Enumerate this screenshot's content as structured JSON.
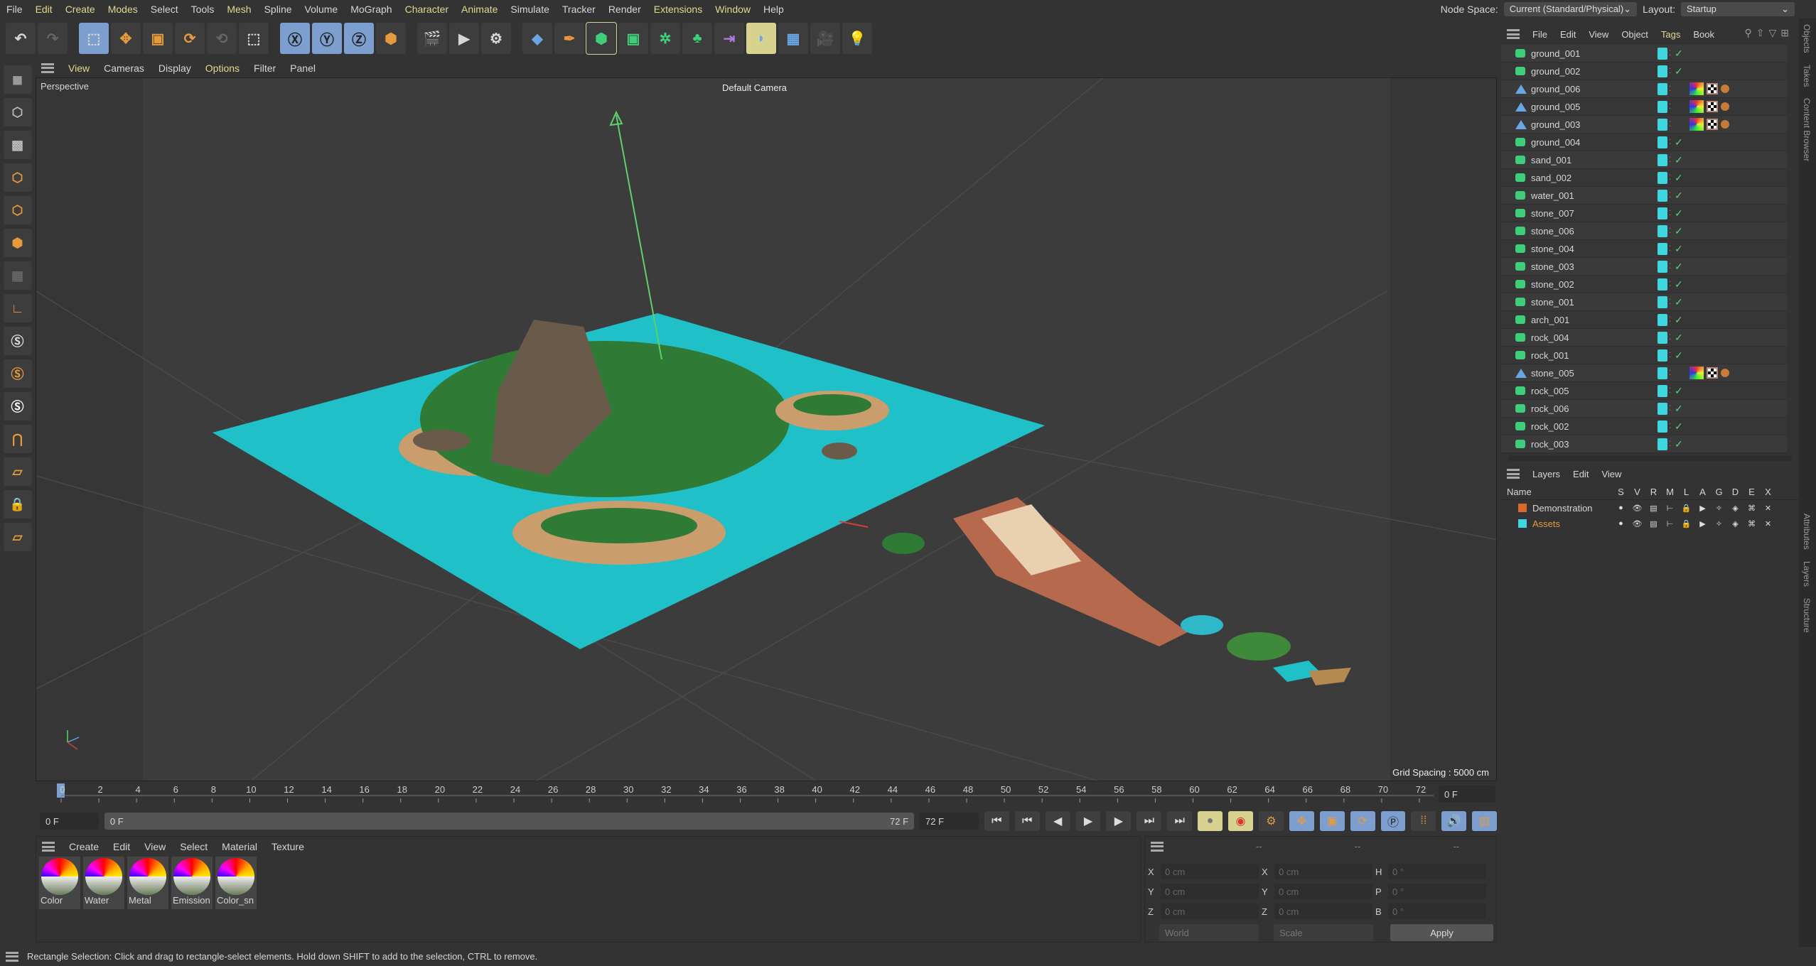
{
  "menu": [
    "File",
    "Edit",
    "Create",
    "Modes",
    "Select",
    "Tools",
    "Mesh",
    "Spline",
    "Volume",
    "MoGraph",
    "Character",
    "Animate",
    "Simulate",
    "Tracker",
    "Render",
    "Extensions",
    "Window",
    "Help"
  ],
  "menu_highlight": [
    1,
    2,
    3,
    6,
    10,
    11,
    15,
    16
  ],
  "node_space": {
    "label": "Node Space:",
    "value": "Current (Standard/Physical)"
  },
  "layout": {
    "label": "Layout:",
    "value": "Startup"
  },
  "viewport_menu": [
    "View",
    "Cameras",
    "Display",
    "Options",
    "Filter",
    "Panel"
  ],
  "viewport": {
    "name": "Perspective",
    "camera": "Default Camera",
    "grid_spacing": "Grid Spacing : 5000 cm",
    "plane_color": "#1fc0c8"
  },
  "timeline": {
    "ticks": [
      0,
      2,
      4,
      6,
      8,
      10,
      12,
      14,
      16,
      18,
      20,
      22,
      24,
      26,
      28,
      30,
      32,
      34,
      36,
      38,
      40,
      42,
      44,
      46,
      48,
      50,
      52,
      54,
      56,
      58,
      60,
      62,
      64,
      66,
      68,
      70,
      72
    ],
    "current_frame": "0 F",
    "start": "0 F",
    "range_start": "0 F",
    "range_end": "72 F",
    "end": "72 F",
    "right_frame": "0 F"
  },
  "materials": {
    "menu": [
      "Create",
      "Edit",
      "View",
      "Select",
      "Material",
      "Texture"
    ],
    "items": [
      "Color",
      "Water",
      "Metal",
      "Emission",
      "Color_sn"
    ]
  },
  "coords": {
    "headers": [
      "--",
      "--",
      "--"
    ],
    "rows": [
      [
        "X",
        "0 cm",
        "X",
        "0 cm",
        "H",
        "0 °"
      ],
      [
        "Y",
        "0 cm",
        "Y",
        "0 cm",
        "P",
        "0 °"
      ],
      [
        "Z",
        "0 cm",
        "Z",
        "0 cm",
        "B",
        "0 °"
      ]
    ],
    "mode1": "World",
    "mode2": "Scale",
    "apply": "Apply"
  },
  "status": "Rectangle Selection: Click and drag to rectangle-select elements. Hold down SHIFT to add to the selection, CTRL to remove.",
  "objects": {
    "menu": [
      "File",
      "Edit",
      "View",
      "Object",
      "Tags",
      "Book"
    ],
    "items": [
      {
        "name": "ground_001",
        "type": "poly"
      },
      {
        "name": "ground_002",
        "type": "poly"
      },
      {
        "name": "ground_006",
        "type": "null",
        "tags": true
      },
      {
        "name": "ground_005",
        "type": "null",
        "tags": true
      },
      {
        "name": "ground_003",
        "type": "null",
        "tags": true
      },
      {
        "name": "ground_004",
        "type": "poly"
      },
      {
        "name": "sand_001",
        "type": "poly"
      },
      {
        "name": "sand_002",
        "type": "poly"
      },
      {
        "name": "water_001",
        "type": "poly"
      },
      {
        "name": "stone_007",
        "type": "poly"
      },
      {
        "name": "stone_006",
        "type": "poly"
      },
      {
        "name": "stone_004",
        "type": "poly"
      },
      {
        "name": "stone_003",
        "type": "poly"
      },
      {
        "name": "stone_002",
        "type": "poly"
      },
      {
        "name": "stone_001",
        "type": "poly"
      },
      {
        "name": "arch_001",
        "type": "poly"
      },
      {
        "name": "rock_004",
        "type": "poly"
      },
      {
        "name": "rock_001",
        "type": "poly"
      },
      {
        "name": "stone_005",
        "type": "null",
        "tags": true
      },
      {
        "name": "rock_005",
        "type": "poly"
      },
      {
        "name": "rock_006",
        "type": "poly"
      },
      {
        "name": "rock_002",
        "type": "poly"
      },
      {
        "name": "rock_003",
        "type": "poly"
      }
    ]
  },
  "layers": {
    "menu": [
      "Layers",
      "Edit",
      "View"
    ],
    "name_header": "Name",
    "columns": [
      "S",
      "V",
      "R",
      "M",
      "L",
      "A",
      "G",
      "D",
      "E",
      "X"
    ],
    "items": [
      {
        "name": "Demonstration",
        "color": "#d9692a"
      },
      {
        "name": "Assets",
        "color": "#3fd6e0"
      }
    ]
  },
  "side_tabs": [
    "Objects",
    "Takes",
    "Content Browser",
    "Attributes",
    "Layers",
    "Structure"
  ]
}
